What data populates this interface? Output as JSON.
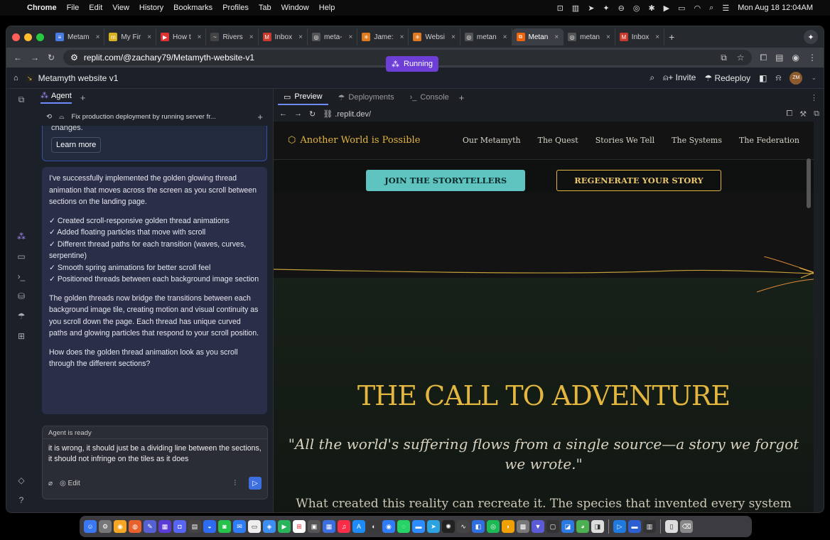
{
  "menubar": {
    "app": "Chrome",
    "items": [
      "File",
      "Edit",
      "View",
      "History",
      "Bookmarks",
      "Profiles",
      "Tab",
      "Window",
      "Help"
    ],
    "clock": "Mon Aug 18  12:04AM"
  },
  "tabs": [
    {
      "label": "Metam",
      "color": "#4a7be0",
      "glyph": "≡"
    },
    {
      "label": "My Fir",
      "color": "#d8b11f",
      "glyph": "m"
    },
    {
      "label": "How t",
      "color": "#e03434",
      "glyph": "▶"
    },
    {
      "label": "Rivers",
      "color": "#444",
      "glyph": "~"
    },
    {
      "label": "Inbox",
      "color": "#c93a2c",
      "glyph": "M"
    },
    {
      "label": "meta-",
      "color": "#555",
      "glyph": "◎"
    },
    {
      "label": "Jame:",
      "color": "#e07a1f",
      "glyph": "✳"
    },
    {
      "label": "Websi",
      "color": "#e07a1f",
      "glyph": "✳"
    },
    {
      "label": "metan",
      "color": "#555",
      "glyph": "◎"
    },
    {
      "label": "Metan",
      "color": "#f26207",
      "glyph": "⧉",
      "active": true
    },
    {
      "label": "metan",
      "color": "#555",
      "glyph": "◎"
    },
    {
      "label": "Inbox",
      "color": "#c93a2c",
      "glyph": "M"
    }
  ],
  "address": {
    "url": "replit.com/@zachary79/Metamyth-website-v1"
  },
  "replit": {
    "project": "Metamyth website v1",
    "status": "Running",
    "invite": "Invite",
    "redeploy": "Redeploy",
    "avatar": "ZM"
  },
  "agent": {
    "tab": "Agent",
    "topic": "Fix production deployment by running server fr...",
    "card_clip": "changes.",
    "learn_more": "Learn more",
    "intro": "I've successfully implemented the golden glowing thread animation that moves across the screen as you scroll between sections on the landing page.",
    "checklist": [
      "✓ Created scroll-responsive golden thread animations",
      "✓ Added floating particles that move with scroll",
      "✓ Different thread paths for each transition (waves, curves, serpentine)",
      "✓ Smooth spring animations for better scroll feel",
      "✓ Positioned threads between each background image section"
    ],
    "explain": "The golden threads now bridge the transitions between each background image tile, creating motion and visual continuity as you scroll down the page. Each thread has unique curved paths and glowing particles that respond to your scroll position.",
    "question": "How does the golden thread animation look as you scroll through the different sections?",
    "status": "Agent is ready",
    "input": "it is wrong, it should just be a dividing line between the sections, it should not infringe on the tiles as it does",
    "edit": "Edit"
  },
  "preview": {
    "tabs": [
      "Preview",
      "Deployments",
      "Console"
    ],
    "url": ".replit.dev/"
  },
  "site": {
    "logo": "Another World is Possible",
    "nav": [
      "Our Metamyth",
      "The Quest",
      "Stories We Tell",
      "The Systems",
      "The Federation"
    ],
    "cta_primary": "JOIN THE STORYTELLERS",
    "cta_secondary": "REGENERATE YOUR STORY",
    "heading": "THE CALL TO ADVENTURE",
    "quote": "\"All the world's suffering flows from a single source—a story we forgot we wrote.\"",
    "body": "What created this reality can recreate it. The species that invented every system"
  },
  "colors": {
    "gold": "#e3b640",
    "teal": "#5fc4c0",
    "replit_purple": "#6d3fd6"
  }
}
